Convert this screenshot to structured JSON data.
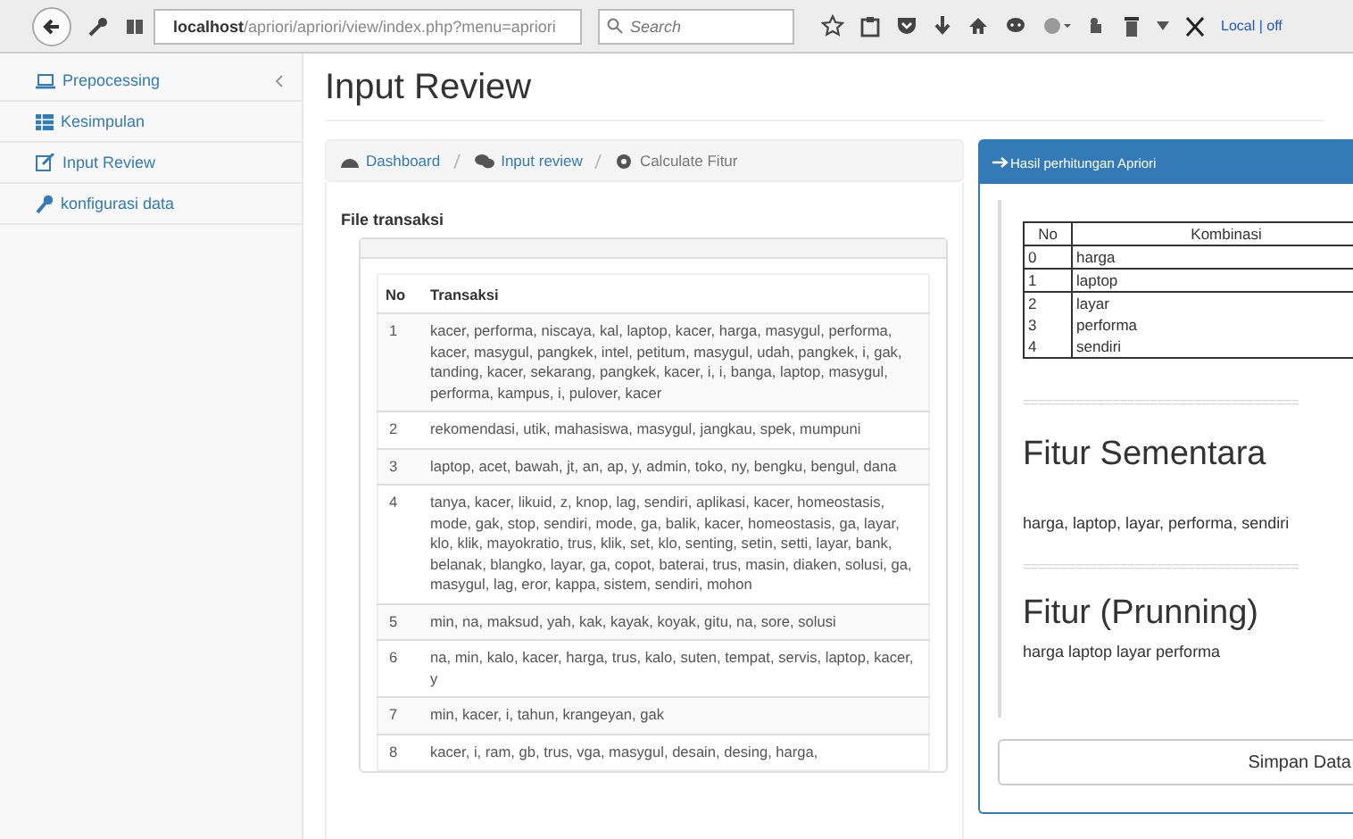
{
  "browser": {
    "url_host": "localhost",
    "url_path": "/apriori/apriori/view/index.php?menu=apriori",
    "search_placeholder": "Search",
    "status": "Local | off"
  },
  "sidebar": {
    "items": [
      {
        "label": "Prepocessing"
      },
      {
        "label": "Kesimpulan"
      },
      {
        "label": "Input Review"
      },
      {
        "label": "konfigurasi data"
      }
    ]
  },
  "page_title": "Input Review",
  "breadcrumb": [
    {
      "label": "Dashboard",
      "active": false
    },
    {
      "label": "Input review",
      "active": false
    },
    {
      "label": "Calculate Fitur",
      "active": true
    }
  ],
  "section_title": "File transaksi",
  "table": {
    "columns": [
      "No",
      "Transaksi"
    ],
    "rows": [
      {
        "no": "1",
        "text": "kacer, performa, niscaya, kal, laptop, kacer, harga, masygul, performa, kacer, masygul, pangkek, intel, petitum, masygul, udah, pangkek, i, gak, tanding, kacer, sekarang, pangkek, kacer, i, i, banga, laptop, masygul, performa, kampus, i, pulover, kacer"
      },
      {
        "no": "2",
        "text": "rekomendasi, utik, mahasiswa, masygul, jangkau, spek, mumpuni"
      },
      {
        "no": "3",
        "text": "laptop, acet, bawah, jt, an, ap, y, admin, toko, ny, bengku, bengul, dana"
      },
      {
        "no": "4",
        "text": "tanya, kacer, likuid, z, knop, lag, sendiri, aplikasi, kacer, homeostasis, mode, gak, stop, sendiri, mode, ga, balik, kacer, homeostasis, ga, layar, klo, klik, mayokratio, trus, klik, set, klo, senting, setin, setti, layar, bank, belanak, blangko, layar, ga, copot, baterai, trus, masin, diaken, solusi, ga, masygul, lag, eror, kappa, sistem, sendiri, mohon"
      },
      {
        "no": "5",
        "text": "min, na, maksud, yah, kak, kayak, koyak, gitu, na, sore, solusi"
      },
      {
        "no": "6",
        "text": "na, min, kalo, kacer, harga, trus, kalo, suten, tempat, servis, laptop, kacer, y"
      },
      {
        "no": "7",
        "text": "min, kacer, i, tahun, krangeyan, gak"
      },
      {
        "no": "8",
        "text": "kacer, i, ram, gb, trus, vga, masygul, desain, desing, harga,"
      }
    ]
  },
  "result_panel": {
    "title": "Hasil perhitungan Apriori",
    "columns": [
      "No",
      "Kombinasi"
    ],
    "rows": [
      {
        "no": "0",
        "item": "harga"
      },
      {
        "no": "1",
        "item": "laptop"
      },
      {
        "no": "2",
        "item": "layar"
      },
      {
        "no": "3",
        "item": "performa"
      },
      {
        "no": "4",
        "item": "sendiri"
      }
    ],
    "separator_1": "=====================================",
    "heading_1": "Fitur Sementara",
    "text_1": "harga, laptop, layar, performa, sendiri",
    "separator_2": "=====================================",
    "heading_2": "Fitur (Prunning)",
    "text_2": "harga laptop layar performa",
    "button": "Simpan Data"
  }
}
